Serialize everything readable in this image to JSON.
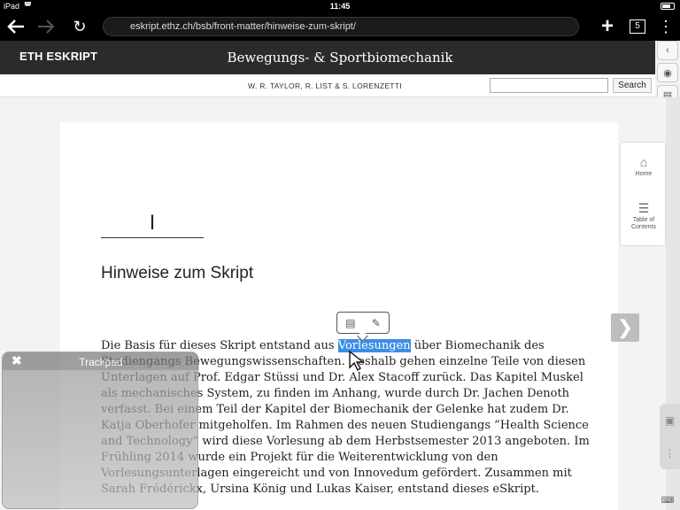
{
  "statusbar": {
    "device": "iPad",
    "time": "11:45"
  },
  "toolbar": {
    "url": "eskript.ethz.ch/bsb/front-matter/hinweise-zum-skript/",
    "tab_count": "5"
  },
  "header": {
    "brand": "ETH ESKRIPT",
    "book_title": "Bewegungs- & Sportbiomechanik"
  },
  "authorbar": {
    "authors": "W. R. TAYLOR, R. LIST & S. LORENZETTI",
    "search_placeholder": "",
    "search_label": "Search"
  },
  "page": {
    "chapter_numeral": "I",
    "heading": "Hinweise zum Skript",
    "highlighted_word": "Vorlesungen",
    "line1_before": "Die Basis für dieses Skript entstand aus ",
    "line1_after": " über Biomechanik des",
    "lines": [
      "Studiengangs Bewegungswissenschaften. Deshalb gehen einzelne Teile von diesen",
      "Unterlagen auf Prof. Edgar Stüssi und Dr. Alex Stacoff zurück.  Das Kapitel Muskel",
      "als mechanisches System, zu finden im Anhang, wurde durch Dr. Jachen Denoth",
      "verfasst. Bei einem Teil der Kapitel der Biomechanik der Gelenke hat zudem Dr.",
      "Katja Oberhofer mitgeholfen. Im Rahmen des neuen Studiengangs ”Health Science",
      "and Technology” wird diese Vorlesung ab dem Herbstsemester 2013 angeboten. Im",
      "Frühling 2014 wurde ein Projekt für die Weiterentwicklung von den",
      "Vorlesungsunterlagen eingereicht und von Innovedum gefördert. Zusammen mit",
      "Sarah Frédérickx, Ursina König und Lukas Kaiser, entstand dieses eSkript."
    ]
  },
  "sidepanel": {
    "home_label": "Home",
    "toc_label": "Table of Contents"
  },
  "trackpad": {
    "title": "Trackpad"
  },
  "colors": {
    "highlight": "#3a8ee6",
    "header_bg": "#2b2b2b",
    "toolbar_bg": "#000000"
  }
}
